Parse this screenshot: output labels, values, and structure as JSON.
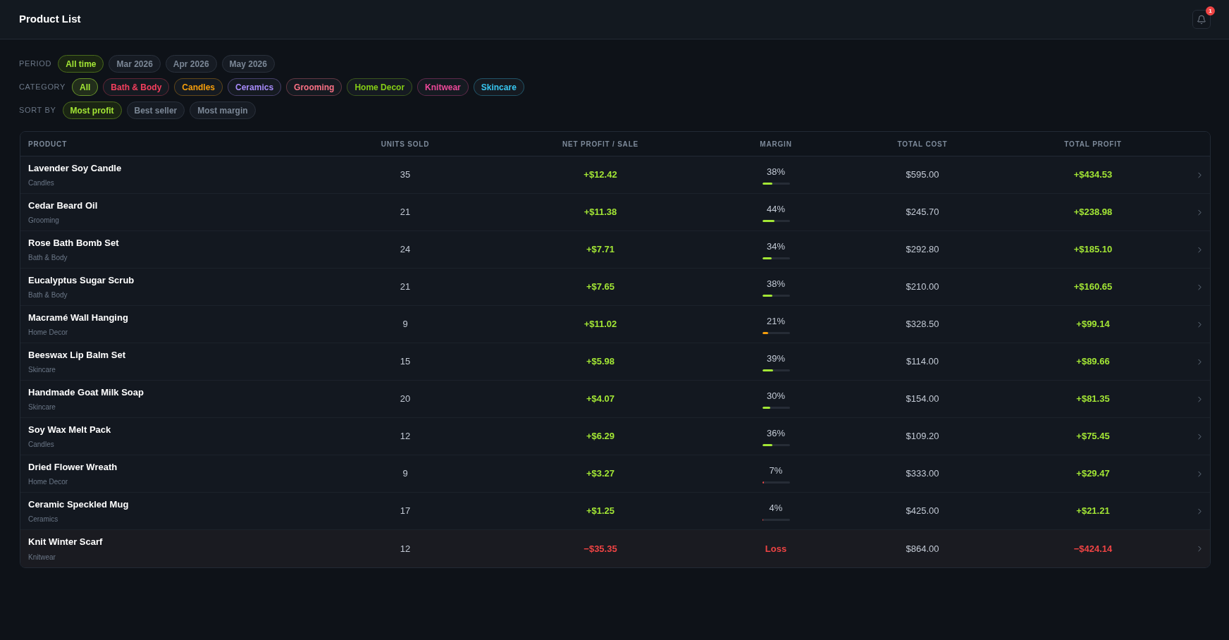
{
  "header": {
    "title": "Product List",
    "notifications": {
      "badge": "1"
    }
  },
  "filters": {
    "period": {
      "label": "PERIOD",
      "options": [
        {
          "label": "All time",
          "selected": true
        },
        {
          "label": "Mar 2026",
          "selected": false
        },
        {
          "label": "Apr 2026",
          "selected": false
        },
        {
          "label": "May 2026",
          "selected": false
        }
      ]
    },
    "category": {
      "label": "CATEGORY",
      "options": [
        {
          "label": "All",
          "selected": true,
          "color": "#a3e635"
        },
        {
          "label": "Bath & Body",
          "selected": false,
          "color": "#f43f5e"
        },
        {
          "label": "Candles",
          "selected": false,
          "color": "#f59e0b"
        },
        {
          "label": "Ceramics",
          "selected": false,
          "color": "#a78bfa"
        },
        {
          "label": "Grooming",
          "selected": false,
          "color": "#fb7185"
        },
        {
          "label": "Home Decor",
          "selected": false,
          "color": "#84cc16"
        },
        {
          "label": "Knitwear",
          "selected": false,
          "color": "#ec4899"
        },
        {
          "label": "Skincare",
          "selected": false,
          "color": "#38c6f0"
        }
      ]
    },
    "sort_by": {
      "label": "SORT BY",
      "options": [
        {
          "label": "Most profit",
          "selected": true
        },
        {
          "label": "Best seller",
          "selected": false
        },
        {
          "label": "Most margin",
          "selected": false
        }
      ]
    }
  },
  "table": {
    "columns": [
      "PRODUCT",
      "UNITS SOLD",
      "NET PROFIT / SALE",
      "MARGIN",
      "TOTAL COST",
      "TOTAL PROFIT"
    ],
    "rows": [
      {
        "name": "Lavender Soy Candle",
        "category": "Candles",
        "units_sold": "35",
        "net_profit_per_sale": "+$12.42",
        "margin": {
          "text": "38%",
          "level": 0.38
        },
        "total_cost": "$595.00",
        "total_profit": "+$434.53",
        "loss": false
      },
      {
        "name": "Cedar Beard Oil",
        "category": "Grooming",
        "units_sold": "21",
        "net_profit_per_sale": "+$11.38",
        "margin": {
          "text": "44%",
          "level": 0.44
        },
        "total_cost": "$245.70",
        "total_profit": "+$238.98",
        "loss": false
      },
      {
        "name": "Rose Bath Bomb Set",
        "category": "Bath & Body",
        "units_sold": "24",
        "net_profit_per_sale": "+$7.71",
        "margin": {
          "text": "34%",
          "level": 0.34
        },
        "total_cost": "$292.80",
        "total_profit": "+$185.10",
        "loss": false
      },
      {
        "name": "Eucalyptus Sugar Scrub",
        "category": "Bath & Body",
        "units_sold": "21",
        "net_profit_per_sale": "+$7.65",
        "margin": {
          "text": "38%",
          "level": 0.38
        },
        "total_cost": "$210.00",
        "total_profit": "+$160.65",
        "loss": false
      },
      {
        "name": "Macramé Wall Hanging",
        "category": "Home Decor",
        "units_sold": "9",
        "net_profit_per_sale": "+$11.02",
        "margin": {
          "text": "21%",
          "level": 0.21
        },
        "total_cost": "$328.50",
        "total_profit": "+$99.14",
        "loss": false
      },
      {
        "name": "Beeswax Lip Balm Set",
        "category": "Skincare",
        "units_sold": "15",
        "net_profit_per_sale": "+$5.98",
        "margin": {
          "text": "39%",
          "level": 0.39
        },
        "total_cost": "$114.00",
        "total_profit": "+$89.66",
        "loss": false
      },
      {
        "name": "Handmade Goat Milk Soap",
        "category": "Skincare",
        "units_sold": "20",
        "net_profit_per_sale": "+$4.07",
        "margin": {
          "text": "30%",
          "level": 0.3
        },
        "total_cost": "$154.00",
        "total_profit": "+$81.35",
        "loss": false
      },
      {
        "name": "Soy Wax Melt Pack",
        "category": "Candles",
        "units_sold": "12",
        "net_profit_per_sale": "+$6.29",
        "margin": {
          "text": "36%",
          "level": 0.36
        },
        "total_cost": "$109.20",
        "total_profit": "+$75.45",
        "loss": false
      },
      {
        "name": "Dried Flower Wreath",
        "category": "Home Decor",
        "units_sold": "9",
        "net_profit_per_sale": "+$3.27",
        "margin": {
          "text": "7%",
          "level": 0.07
        },
        "total_cost": "$333.00",
        "total_profit": "+$29.47",
        "loss": false
      },
      {
        "name": "Ceramic Speckled Mug",
        "category": "Ceramics",
        "units_sold": "17",
        "net_profit_per_sale": "+$1.25",
        "margin": {
          "text": "4%",
          "level": 0.04
        },
        "total_cost": "$425.00",
        "total_profit": "+$21.21",
        "loss": false
      },
      {
        "name": "Knit Winter Scarf",
        "category": "Knitwear",
        "units_sold": "12",
        "net_profit_per_sale": "−$35.35",
        "margin": {
          "text": "Loss"
        },
        "total_cost": "$864.00",
        "total_profit": "−$424.14",
        "loss": true
      }
    ]
  }
}
